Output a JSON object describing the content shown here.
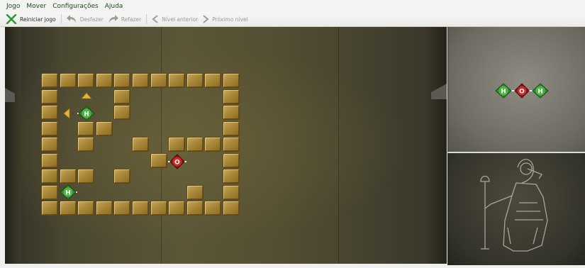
{
  "menu": {
    "items": [
      "Jogo",
      "Mover",
      "Configurações",
      "Ajuda"
    ]
  },
  "toolbar": {
    "restart": "Reiniciar jogo",
    "undo": "Desfazer",
    "redo": "Refazer",
    "prev_level": "Nível anterior",
    "next_level": "Próximo nível"
  },
  "atoms": {
    "hydrogen": "H",
    "oxygen": "O"
  },
  "colors": {
    "hydrogen": "#3f9b3a",
    "oxygen": "#b31b1b",
    "wall": "#a98838",
    "accent": "#2f7a2b"
  },
  "icons": {
    "restart": "restart-icon",
    "undo": "undo-icon",
    "redo": "redo-icon",
    "prev": "chevron-left-icon",
    "next": "chevron-right-icon"
  }
}
